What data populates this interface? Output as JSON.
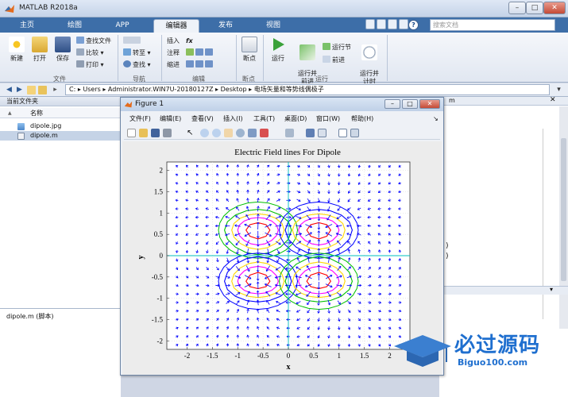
{
  "app": {
    "title": "MATLAB R2018a"
  },
  "window_controls": {
    "minimize": "–",
    "maximize": "□",
    "close": "✕"
  },
  "tabs": [
    {
      "label": "主页",
      "active": false
    },
    {
      "label": "绘图",
      "active": false
    },
    {
      "label": "APP",
      "active": false
    },
    {
      "label": "编辑器",
      "active": true
    },
    {
      "label": "发布",
      "active": false
    },
    {
      "label": "视图",
      "active": false
    }
  ],
  "search": {
    "placeholder": "搜索文档"
  },
  "help_label": "?",
  "ribbon": {
    "file": {
      "new": "新建",
      "open": "打开",
      "save": "保存",
      "find_files": "查找文件",
      "compare": "比较",
      "print": "打印",
      "group": "文件"
    },
    "navigate": {
      "goto": "转至",
      "find": "查找",
      "group": "导航"
    },
    "edit": {
      "insert": "插入",
      "comment": "注释",
      "indent": "缩进",
      "group": "编辑",
      "fx": "fx"
    },
    "breakpoint": {
      "label": "断点",
      "group": "断点"
    },
    "run": {
      "run": "运行",
      "run_advance": "运行并\n前进",
      "run_section": "运行节",
      "advance": "前进",
      "run_time": "运行并\n计时",
      "group": "运行"
    }
  },
  "address": {
    "segments": "C: ▸ Users ▸ Administrator.WIN7U-20180127Z ▸ Desktop ▸ 电场矢量和等势线偶极子"
  },
  "current_folder": {
    "title": "当前文件夹",
    "column_name": "名称",
    "sort_arrow": "▲",
    "files": [
      {
        "name": "dipole.jpg",
        "selected": false
      },
      {
        "name": "dipole.m",
        "selected": true
      }
    ],
    "details": "dipole.m (脚本)"
  },
  "figure": {
    "title": "Figure 1",
    "menu": [
      "文件(F)",
      "编辑(E)",
      "查看(V)",
      "插入(I)",
      "工具(T)",
      "桌面(D)",
      "窗口(W)",
      "帮助(H)"
    ],
    "menu_arrow": "↘"
  },
  "right_fragments": {
    "tab_label": "m",
    "line1": ")",
    "line2": ")"
  },
  "chart_data": {
    "type": "quiver",
    "title": "Electric Field lines For Dipole",
    "xlabel": "x",
    "ylabel": "y",
    "xlim": [
      -2.4,
      2.4
    ],
    "ylim": [
      -2.2,
      2.2
    ],
    "xticks": [
      "-2",
      "-1.5",
      "-1",
      "-0.5",
      "0",
      "0.5",
      "1",
      "1.5",
      "2"
    ],
    "yticks": [
      "2",
      "1.5",
      "1",
      "0.5",
      "0",
      "-0.5",
      "-1",
      "-1.5",
      "-2"
    ],
    "grid": true,
    "charges": [
      {
        "x": -0.6,
        "y": 0.6,
        "q": 1
      },
      {
        "x": 0.6,
        "y": 0.6,
        "q": -1
      },
      {
        "x": -0.6,
        "y": -0.6,
        "q": -1
      },
      {
        "x": 0.6,
        "y": -0.6,
        "q": 1
      }
    ],
    "contour_colors": [
      "#00c000",
      "#ffd700",
      "#ff00ff",
      "#ff0000",
      "#0000ff"
    ],
    "arrow_color": "#0000ff",
    "axis_line_color": "#00bfbf"
  },
  "brand": {
    "main": "必过源码",
    "sub": "Biguo100.com"
  }
}
